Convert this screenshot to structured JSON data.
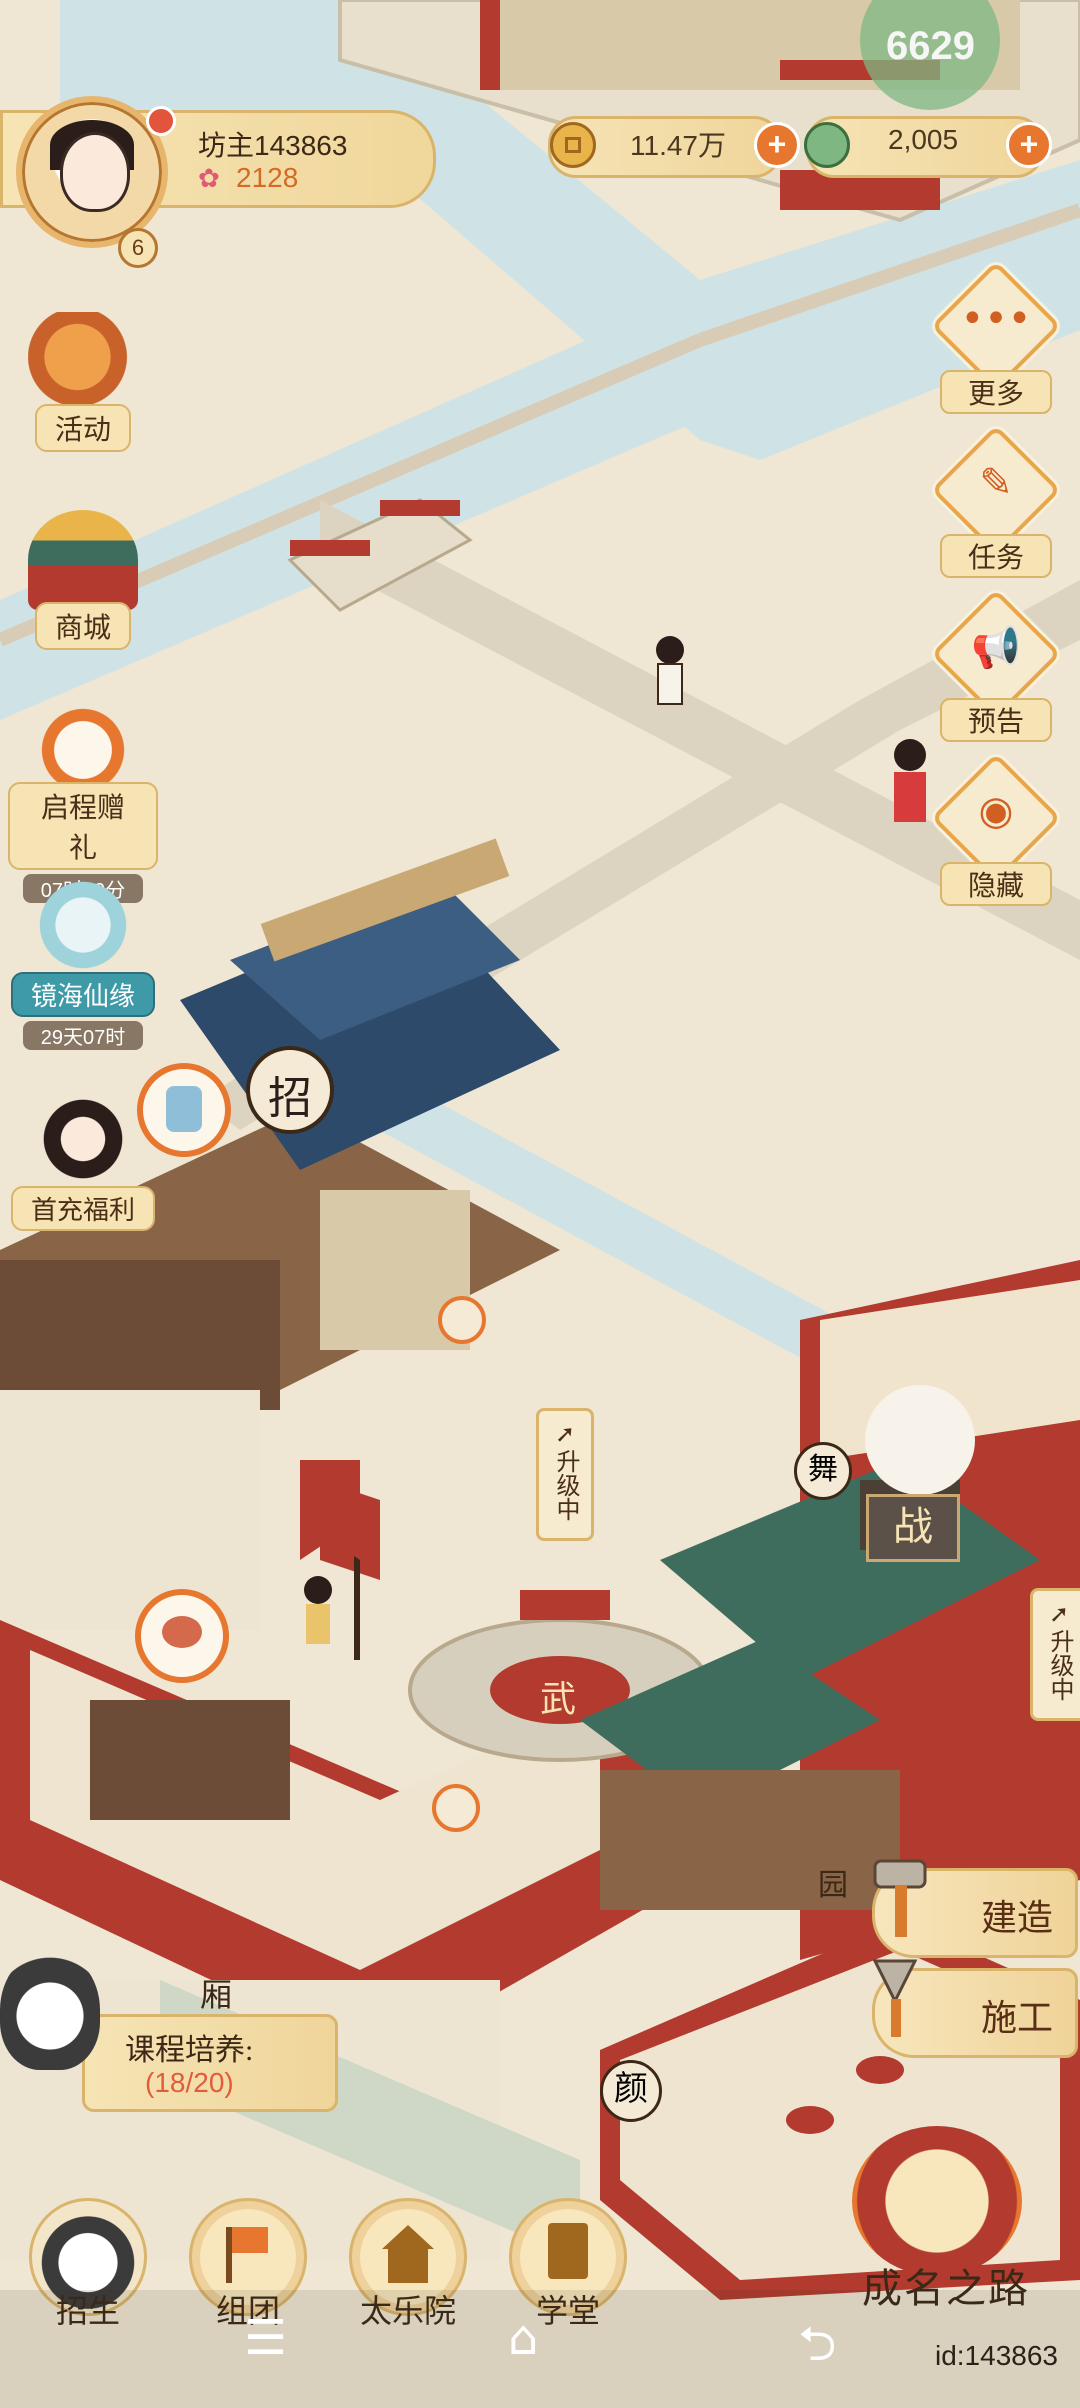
{
  "player": {
    "name": "坊主143863",
    "score": "2128",
    "level": "6"
  },
  "currency": {
    "coins": "11.47万",
    "jade": "2,005",
    "top_partial": "6629"
  },
  "left_menu": [
    {
      "label": "活动"
    },
    {
      "label": "商城"
    },
    {
      "label": "启程赠礼",
      "sub": "07时49分"
    },
    {
      "label": "镜海仙缘",
      "sub": "29天07时"
    },
    {
      "label": "首充福利"
    }
  ],
  "right_menu": [
    {
      "label": "更多"
    },
    {
      "label": "任务"
    },
    {
      "label": "预告"
    },
    {
      "label": "隐藏"
    }
  ],
  "actions": {
    "build": "建造",
    "construct": "施工"
  },
  "upgrade_label": "升级中",
  "building_signs": {
    "recruit": "招",
    "battle": "战",
    "dance": "舞",
    "martial": "武",
    "garden": "园",
    "face": "颜",
    "rise": "厢"
  },
  "course": {
    "title": "课程培养:",
    "count": "(18/20)"
  },
  "bottom_nav": [
    {
      "label": "招生"
    },
    {
      "label": "组团"
    },
    {
      "label": "太乐院"
    },
    {
      "label": "学堂"
    }
  ],
  "fame_road": "成名之路",
  "user_id": "id:143863",
  "colors": {
    "ground": "#efe6d3",
    "water": "#cfe3e6",
    "path": "#e0d8c6",
    "roof_blue": "#2d4a6b",
    "roof_green": "#3f6d5d",
    "wall_red": "#b23a2e",
    "accent": "#e7772e"
  }
}
